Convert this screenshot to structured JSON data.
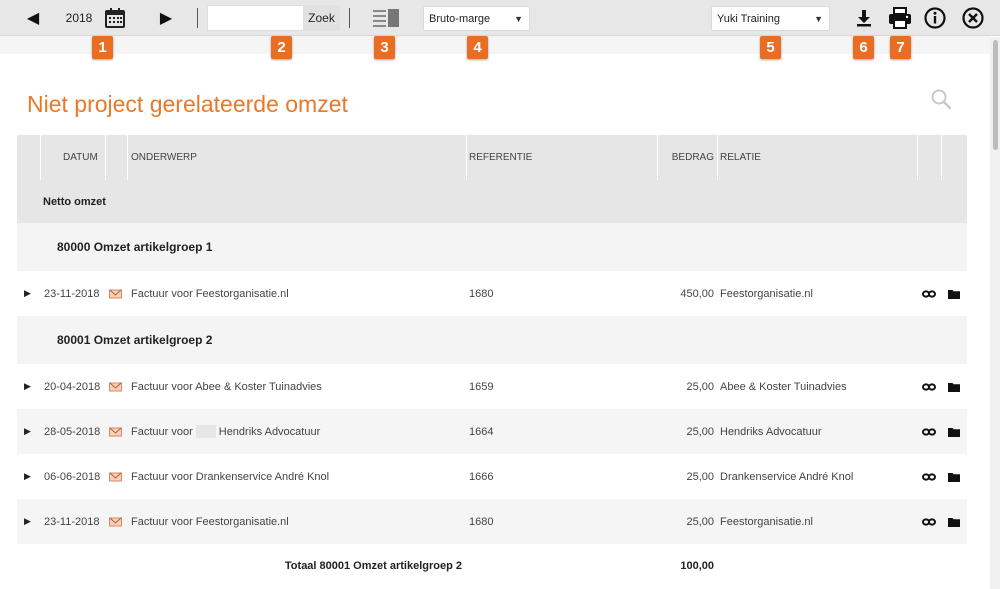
{
  "toolbar": {
    "year": "2018",
    "search_placeholder": "",
    "search_button": "Zoek",
    "view_select": "Bruto-marge",
    "admin_select": "Yuki Training"
  },
  "badges": [
    "1",
    "2",
    "3",
    "4",
    "5",
    "6",
    "7"
  ],
  "page": {
    "title": "Niet project gerelateerde omzet"
  },
  "table": {
    "columns": {
      "datum": "DATUM",
      "onderwerp": "ONDERWERP",
      "referentie": "REFERENTIE",
      "bedrag": "BEDRAG",
      "relatie": "RELATIE"
    },
    "section": "Netto omzet",
    "groups": [
      {
        "name": "80000 Omzet artikelgroep 1",
        "rows": [
          {
            "datum": "23-11-2018",
            "onderwerp": "Factuur voor Feestorganisatie.nl",
            "referentie": "1680",
            "bedrag": "450,00",
            "relatie": "Feestorganisatie.nl"
          }
        ]
      },
      {
        "name": "80001 Omzet artikelgroep 2",
        "rows": [
          {
            "datum": "20-04-2018",
            "onderwerp": "Factuur voor Abee & Koster Tuinadvies",
            "referentie": "1659",
            "bedrag": "25,00",
            "relatie": "Abee & Koster Tuinadvies"
          },
          {
            "datum": "28-05-2018",
            "onderwerp_prefix": "Factuur voor",
            "onderwerp_suffix": "Hendriks Advocatuur",
            "referentie": "1664",
            "bedrag": "25,00",
            "relatie": "Hendriks Advocatuur"
          },
          {
            "datum": "06-06-2018",
            "onderwerp": "Factuur voor Drankenservice André Knol",
            "referentie": "1666",
            "bedrag": "25,00",
            "relatie": "Drankenservice André Knol"
          },
          {
            "datum": "23-11-2018",
            "onderwerp": "Factuur voor Feestorganisatie.nl",
            "referentie": "1680",
            "bedrag": "25,00",
            "relatie": "Feestorganisatie.nl"
          }
        ],
        "total_label": "Totaal 80001 Omzet artikelgroep 2",
        "total_value": "100,00"
      }
    ]
  },
  "colors": {
    "accent": "#e8792b",
    "badge": "#e96e23",
    "toolbar_bg": "#e7e7e7"
  },
  "icons": [
    "previous-arrow-icon",
    "calendar-icon",
    "next-arrow-icon",
    "layout-toggle-icon",
    "download-icon",
    "print-icon",
    "info-icon",
    "close-circle-icon",
    "search-icon",
    "expand-chevron-icon",
    "invoice-icon",
    "link-icon",
    "folder-icon"
  ]
}
